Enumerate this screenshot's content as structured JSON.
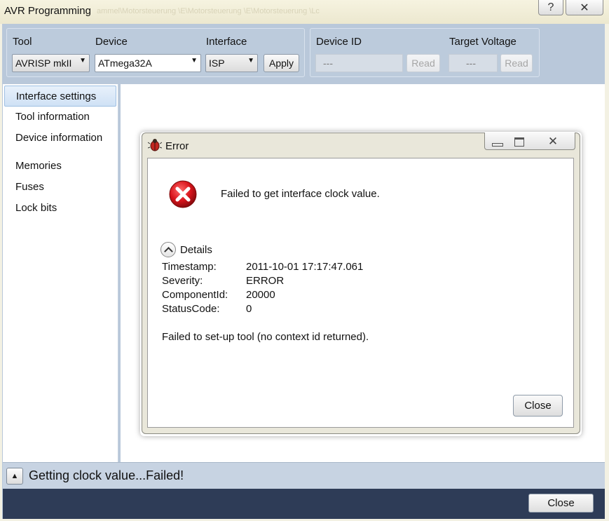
{
  "window": {
    "title": "AVR Programming",
    "background_title": "ammel\\Motorsteuerung \\E\\Motorsteuerung \\E\\Motorsteuerung \\Lc",
    "help_icon": "?",
    "close_icon": "✕"
  },
  "toolbar": {
    "tool_label": "Tool",
    "tool_value": "AVRISP mkII",
    "device_label": "Device",
    "device_value": "ATmega32A",
    "interface_label": "Interface",
    "interface_value": "ISP",
    "apply_label": "Apply",
    "device_id_label": "Device ID",
    "device_id_value": "---",
    "device_id_read": "Read",
    "voltage_label": "Target Voltage",
    "voltage_value": "---",
    "voltage_read": "Read"
  },
  "nav": {
    "items": [
      {
        "label": "Interface settings"
      },
      {
        "label": "Tool information"
      },
      {
        "label": "Device information"
      },
      {
        "label": "Memories"
      },
      {
        "label": "Fuses"
      },
      {
        "label": "Lock bits"
      }
    ]
  },
  "dialog": {
    "title": "Error",
    "message": "Failed to get interface clock value.",
    "details_label": "Details",
    "details": [
      {
        "key": "Timestamp:",
        "value": "2011-10-01 17:17:47.061"
      },
      {
        "key": "Severity:",
        "value": "ERROR"
      },
      {
        "key": "ComponentId:",
        "value": "20000"
      },
      {
        "key": "StatusCode:",
        "value": "0"
      }
    ],
    "extra": "Failed to set-up tool (no context id returned).",
    "close_label": "Close"
  },
  "status": {
    "text": "Getting clock value...Failed!",
    "close_label": "Close"
  },
  "colors": {
    "frame": "#b9c8da",
    "bottom_bar": "#2e3c57",
    "error_red": "#d8141b"
  }
}
